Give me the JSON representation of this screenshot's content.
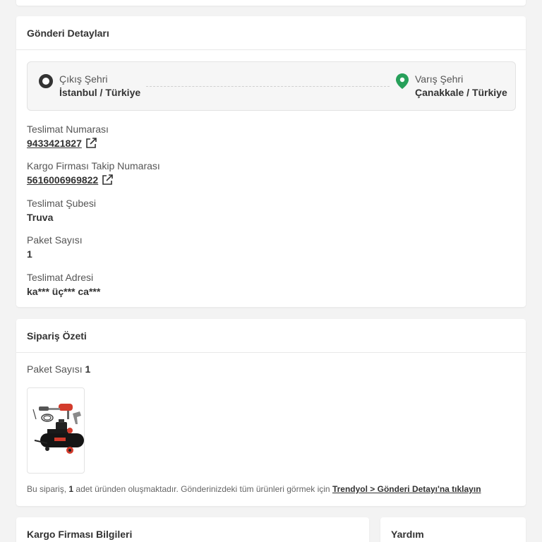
{
  "shipment": {
    "title": "Gönderi Detayları",
    "origin": {
      "label": "Çıkış Şehri",
      "city": "İstanbul / Türkiye"
    },
    "destination": {
      "label": "Varış Şehri",
      "city": "Çanakkale / Türkiye"
    },
    "fields": {
      "delivery_number": {
        "label": "Teslimat Numarası",
        "value": "9433421827"
      },
      "tracking_number": {
        "label": "Kargo Firması Takip Numarası",
        "value": "5616006969822"
      },
      "branch": {
        "label": "Teslimat Şubesi",
        "value": "Truva"
      },
      "package_count": {
        "label": "Paket Sayısı",
        "value": "1"
      },
      "address": {
        "label": "Teslimat Adresi",
        "value": "ka*** üç*** ca***"
      }
    }
  },
  "order_summary": {
    "title": "Sipariş Özeti",
    "package_label": "Paket Sayısı",
    "package_count": "1",
    "note_prefix": "Bu sipariş,",
    "note_count": "1",
    "note_middle": "adet üründen oluşmaktadır. Gönderinizdeki tüm ürünleri görmek için",
    "note_link": "Trendyol > Gönderi Detayı'na tıklayın"
  },
  "cargo_info": {
    "title": "Kargo Firması Bilgileri"
  },
  "help": {
    "title": "Yardım"
  },
  "icons": {
    "origin": "origin-ring-icon",
    "destination": "location-pin-icon",
    "external_link": "external-link-icon",
    "product": "air-compressor-product-image"
  },
  "colors": {
    "accent_green": "#27a05a",
    "text_dark": "#333333",
    "text_muted": "#555555",
    "background": "#f3f3f3"
  }
}
